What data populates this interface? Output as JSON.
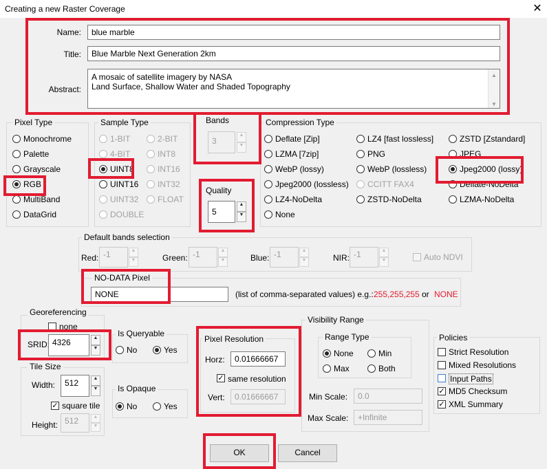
{
  "window": {
    "title": "Creating a new Raster Coverage",
    "close_glyph": "✕"
  },
  "identity": {
    "name_label": "Name:",
    "name_value": "blue marble",
    "title_label": "Title:",
    "title_value": "Blue Marble Next Generation 2km",
    "abstract_label": "Abstract:",
    "abstract_line1": "A mosaic of satellite imagery by NASA",
    "abstract_line2": "Land Surface, Shallow Water and Shaded Topography"
  },
  "pixel_type": {
    "title": "Pixel Type",
    "options": [
      "Monochrome",
      "Palette",
      "Grayscale",
      "RGB",
      "MultiBand",
      "DataGrid"
    ],
    "selected": "RGB"
  },
  "sample_type": {
    "title": "Sample Type",
    "options": [
      "1-BIT",
      "2-BIT",
      "4-BIT",
      "INT8",
      "UINT8",
      "INT16",
      "UINT16",
      "INT32",
      "UINT32",
      "FLOAT",
      "DOUBLE"
    ],
    "selected": "UINT8"
  },
  "bands": {
    "title": "Bands",
    "value": "3"
  },
  "quality": {
    "title": "Quality",
    "value": "5"
  },
  "compression": {
    "title": "Compression Type",
    "options": [
      "Deflate [Zip]",
      "LZ4 [fast lossless]",
      "ZSTD [Zstandard]",
      "LZMA [7zip]",
      "PNG",
      "JPEG",
      "WebP (lossy)",
      "WebP (lossless)",
      "Jpeg2000 (lossy)",
      "Jpeg2000 (lossless)",
      "CCITT FAX4",
      "Deflate-NoDelta",
      "LZ4-NoDelta",
      "ZSTD-NoDelta",
      "LZMA-NoDelta",
      "None"
    ],
    "selected": "Jpeg2000 (lossy)"
  },
  "bands_selection": {
    "title": "Default bands selection",
    "red_label": "Red:",
    "red_value": "-1",
    "green_label": "Green:",
    "green_value": "-1",
    "blue_label": "Blue:",
    "blue_value": "-1",
    "nir_label": "NIR:",
    "nir_value": "-1",
    "auto_ndvi_label": "Auto NDVI"
  },
  "nodata": {
    "title": "NO-DATA Pixel",
    "value": "NONE",
    "hint": "(list of comma-separated values) e.g.:",
    "example1": "255,255,255",
    "or_text": "or",
    "example2": "NONE"
  },
  "georef": {
    "title": "Georeferencing",
    "none_label": "none",
    "srid_label": "SRID:",
    "srid_value": "4326"
  },
  "queryable": {
    "title": "Is Queryable",
    "options": [
      "No",
      "Yes"
    ],
    "selected": "Yes"
  },
  "opaque": {
    "title": "Is Opaque",
    "options": [
      "No",
      "Yes"
    ],
    "selected": "No"
  },
  "tile_size": {
    "title": "Tile Size",
    "width_label": "Width:",
    "width_value": "512",
    "square_label": "square tile",
    "height_label": "Height:",
    "height_value": "512"
  },
  "pixel_resolution": {
    "title": "Pixel Resolution",
    "horz_label": "Horz:",
    "horz_value": "0.01666667",
    "same_label": "same resolution",
    "vert_label": "Vert:",
    "vert_value": "0.01666667"
  },
  "visibility": {
    "title": "Visibility Range",
    "range_type_title": "Range Type",
    "options": [
      "None",
      "Min",
      "Max",
      "Both"
    ],
    "selected": "None",
    "min_scale_label": "Min Scale:",
    "min_scale_value": "0.0",
    "max_scale_label": "Max Scale:",
    "max_scale_value": "+Infinite"
  },
  "policies": {
    "title": "Policies",
    "items": [
      "Strict Resolution",
      "Mixed Resolutions",
      "Input Paths",
      "MD5 Checksum",
      "XML Summary"
    ],
    "checked": [
      "MD5 Checksum",
      "XML Summary"
    ]
  },
  "buttons": {
    "ok": "OK",
    "cancel": "Cancel"
  },
  "colors": {
    "highlight": "#e21b31",
    "background": "#f0f0f0"
  }
}
